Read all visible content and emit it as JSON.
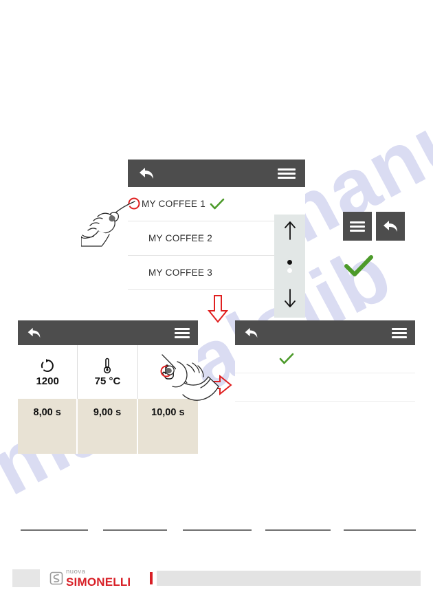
{
  "panels": {
    "coffee_list": {
      "titlebar": {
        "back_icon": "back-arrow-icon",
        "menu_icon": "hamburger-menu-icon"
      },
      "rows": [
        {
          "label": "MY COFFEE 1",
          "selected": true,
          "check_icon": "green-check-icon"
        },
        {
          "label": "MY COFFEE 2",
          "selected": false,
          "check_icon": ""
        },
        {
          "label": "MY COFFEE 3",
          "selected": false,
          "check_icon": ""
        }
      ],
      "scroll": {
        "up_icon": "arrow-up-icon",
        "down_icon": "arrow-down-icon",
        "dot_active": "page-dot-active",
        "dot_inactive": "page-dot-inactive"
      }
    },
    "parameters": {
      "titlebar": {
        "back_icon": "back-arrow-icon",
        "menu_icon": "hamburger-menu-icon"
      },
      "columns": [
        {
          "icon": "rotation-speed-icon",
          "value": "1200",
          "time": "8,00 s"
        },
        {
          "icon": "thermometer-icon",
          "value": "75 °C",
          "time": "9,00 s"
        },
        {
          "icon": "touch-hand-icon",
          "value": "",
          "time": "10,00 s"
        }
      ]
    },
    "confirm": {
      "titlebar": {
        "back_icon": "back-arrow-icon",
        "menu_icon": "hamburger-menu-icon"
      },
      "rows": [
        {
          "label": "",
          "check_icon": "green-check-icon"
        },
        {
          "label": "",
          "check_icon": ""
        },
        {
          "label": "",
          "check_icon": ""
        }
      ]
    }
  },
  "legend": {
    "menu_icon": "hamburger-menu-icon",
    "back_icon": "back-arrow-icon",
    "check_icon": "green-check-icon"
  },
  "annotations": {
    "arrow_down": "red-arrow-down",
    "arrow_right": "red-arrow-right",
    "hand_list": "pointing-hand-illustration",
    "hand_params": "pointing-hand-illustration",
    "target_list": "red-target-circle",
    "target_params": "red-target-circle"
  },
  "footer": {
    "page_number": "",
    "logo_top": "nuova",
    "logo_bottom": "SIMONELLI",
    "logo_mark": "simonelli-logo-icon"
  },
  "watermark": {
    "line_a": "manualslib",
    "line_b": "manualslib"
  },
  "colors": {
    "titlebar": "#4d4d4d",
    "beige_cell": "#e8e2d4",
    "rail": "#e2e7e6",
    "green_check": "#4c9a2a",
    "annotation_red": "#e02020",
    "brand_red": "#d81f26",
    "logo_grey": "#9b9b9b"
  }
}
